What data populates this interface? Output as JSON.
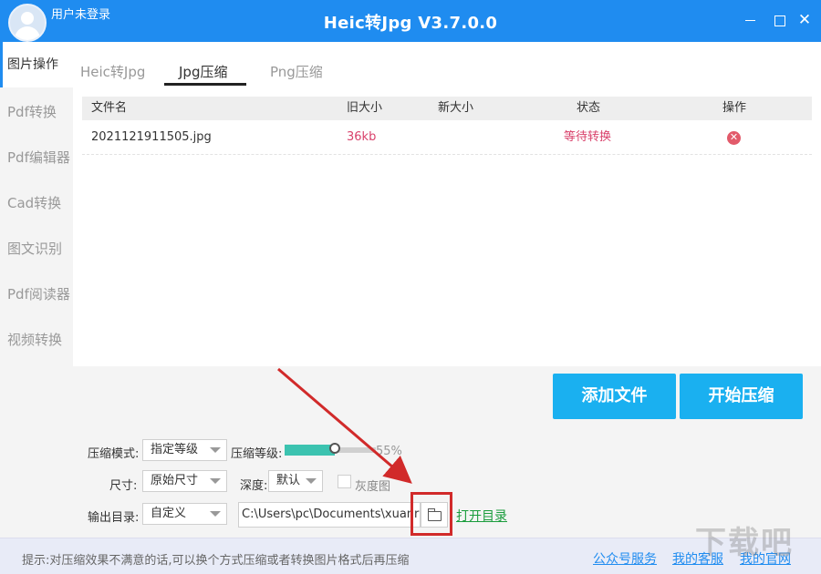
{
  "titlebar": {
    "user_label": "用户未登录",
    "app_title": "Heic转Jpg V3.7.0.0",
    "close_glyph": "✕"
  },
  "sidebar": {
    "items": [
      {
        "label": "图片操作"
      },
      {
        "label": "Pdf转换"
      },
      {
        "label": "Pdf编辑器"
      },
      {
        "label": "Cad转换"
      },
      {
        "label": "图文识别"
      },
      {
        "label": "Pdf阅读器"
      },
      {
        "label": "视频转换"
      }
    ],
    "active_index": 0
  },
  "tabs": [
    {
      "label": "Heic转Jpg"
    },
    {
      "label": "Jpg压缩"
    },
    {
      "label": "Png压缩"
    }
  ],
  "active_tab": 1,
  "table": {
    "columns": [
      "文件名",
      "旧大小",
      "新大小",
      "状态",
      "操作"
    ],
    "rows": [
      {
        "filename": "2021121911505.jpg",
        "old_size": "36kb",
        "new_size": "",
        "status": "等待转换",
        "action_icon": "delete-icon"
      }
    ]
  },
  "buttons": {
    "add_files": "添加文件",
    "start_compress": "开始压缩"
  },
  "options": {
    "mode_label": "压缩模式:",
    "mode_value": "指定等级",
    "level_label": "压缩等级:",
    "level_percent": 55,
    "level_text": "55%",
    "size_label": "尺寸:",
    "size_value": "原始尺寸",
    "depth_label": "深度:",
    "depth_value": "默认",
    "grayscale_label": "灰度图",
    "grayscale_checked": false,
    "output_label": "输出目录:",
    "output_mode": "自定义",
    "output_path": "C:\\Users\\pc\\Documents\\xuanr",
    "open_dir": "打开目录"
  },
  "footer": {
    "tip": "提示:对压缩效果不满意的话,可以换个方式压缩或者转换图片格式后再压缩",
    "links": [
      "公众号服务",
      "我的客服",
      "我的官网"
    ]
  },
  "colors": {
    "titlebar": "#1f8cf0",
    "button": "#1ab0f0",
    "slider_fill": "#3cc3b0",
    "status_red": "#d9416b",
    "annotation_red": "#d12a2a"
  }
}
